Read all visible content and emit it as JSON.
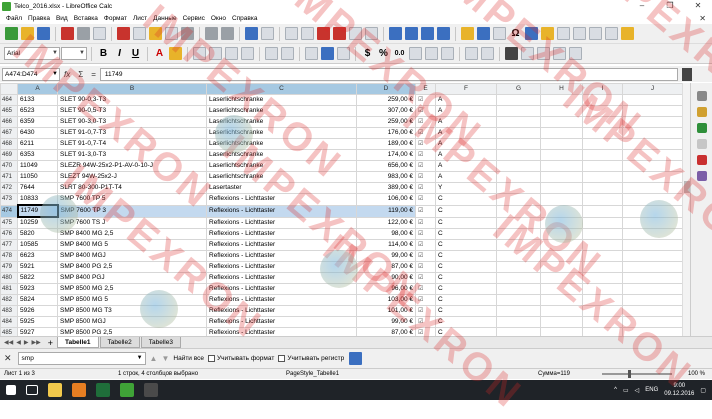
{
  "window": {
    "title": "Telco_2016.xlsx - LibreOffice Calc"
  },
  "menu": [
    "Файл",
    "Правка",
    "Вид",
    "Вставка",
    "Формат",
    "Лист",
    "Данные",
    "Сервис",
    "Окно",
    "Справка"
  ],
  "toolbar": {
    "font_name": "Arial",
    "currency_symbol": "$",
    "percent_symbol": "%",
    "number_format": "0.0",
    "omega_symbol": "Ω"
  },
  "formula_bar": {
    "name_box": "A474:D474",
    "fx_symbol": "fx",
    "sum_symbol": "Σ",
    "equals_symbol": "=",
    "content": "11749"
  },
  "columns": [
    "A",
    "B",
    "C",
    "D",
    "E",
    "F",
    "G",
    "H",
    "I",
    "J"
  ],
  "rows": [
    {
      "n": "464",
      "a": "6133",
      "b": "SLET 90-0,3-T3",
      "c": "Laserlichtschranke",
      "d": "259,00 €",
      "e": "☑",
      "f": "A"
    },
    {
      "n": "465",
      "a": "6523",
      "b": "SLET 90-0,5-T3",
      "c": "Laserlichtschranke",
      "d": "307,00 €",
      "e": "☑",
      "f": "A"
    },
    {
      "n": "466",
      "a": "6359",
      "b": "SLET 90-3,0-T3",
      "c": "Laserlichtschranke",
      "d": "259,00 €",
      "e": "☑",
      "f": "A"
    },
    {
      "n": "467",
      "a": "6430",
      "b": "SLET 91-0,7-T3",
      "c": "Laserlichtschranke",
      "d": "176,00 €",
      "e": "☑",
      "f": "A"
    },
    {
      "n": "468",
      "a": "6211",
      "b": "SLET 91-0,7-T4",
      "c": "Laserlichtschranke",
      "d": "189,00 €",
      "e": "☑",
      "f": "A"
    },
    {
      "n": "469",
      "a": "6353",
      "b": "SLET 91-3,0-T3",
      "c": "Laserlichtschranke",
      "d": "174,00 €",
      "e": "☑",
      "f": "A"
    },
    {
      "n": "470",
      "a": "11049",
      "b": "SLEZR 94W-25x2-P1-AV-0-10-J",
      "c": "Laserlichtschranke",
      "d": "656,00 €",
      "e": "☑",
      "f": "A"
    },
    {
      "n": "471",
      "a": "11050",
      "b": "SLEZT 94W-25x2-J",
      "c": "Laserlichtschranke",
      "d": "983,00 €",
      "e": "☑",
      "f": "A"
    },
    {
      "n": "472",
      "a": "7644",
      "b": "SLRT 80-300-P1T-T4",
      "c": "Lasertaster",
      "d": "389,00 €",
      "e": "☑",
      "f": "Y"
    },
    {
      "n": "473",
      "a": "10833",
      "b": "SMP 7600 TP 5",
      "c": "Reflexions - Lichttaster",
      "d": "106,00 €",
      "e": "☑",
      "f": "C"
    },
    {
      "n": "474",
      "a": "11749",
      "b": "SMP 7600 TP 3",
      "c": "Reflexions - Lichttaster",
      "d": "119,00 €",
      "e": "☑",
      "f": "C"
    },
    {
      "n": "475",
      "a": "10259",
      "b": "SMP 7600 TS J",
      "c": "Reflexions - Lichttaster",
      "d": "122,00 €",
      "e": "☑",
      "f": "C"
    },
    {
      "n": "476",
      "a": "5820",
      "b": "SMP 8400 MG 2,5",
      "c": "Reflexions - Lichttaster",
      "d": "98,00 €",
      "e": "☑",
      "f": "C"
    },
    {
      "n": "477",
      "a": "10585",
      "b": "SMP 8400 MG 5",
      "c": "Reflexions - Lichttaster",
      "d": "114,00 €",
      "e": "☑",
      "f": "C"
    },
    {
      "n": "478",
      "a": "6623",
      "b": "SMP 8400 MGJ",
      "c": "Reflexions - Lichttaster",
      "d": "99,00 €",
      "e": "☑",
      "f": "C"
    },
    {
      "n": "479",
      "a": "5921",
      "b": "SMP 8400 PG 2,5",
      "c": "Reflexions - Lichttaster",
      "d": "87,00 €",
      "e": "☑",
      "f": "C"
    },
    {
      "n": "480",
      "a": "5822",
      "b": "SMP 8400 PGJ",
      "c": "Reflexions - Lichttaster",
      "d": "90,00 €",
      "e": "☑",
      "f": "C"
    },
    {
      "n": "481",
      "a": "5923",
      "b": "SMP 8500 MG 2,5",
      "c": "Reflexions - Lichttaster",
      "d": "96,00 €",
      "e": "☑",
      "f": "C"
    },
    {
      "n": "482",
      "a": "5824",
      "b": "SMP 8500 MG 5",
      "c": "Reflexions - Lichttaster",
      "d": "103,00 €",
      "e": "☑",
      "f": "C"
    },
    {
      "n": "483",
      "a": "5926",
      "b": "SMP 8500 MG T3",
      "c": "Reflexions - Lichttaster",
      "d": "101,00 €",
      "e": "☑",
      "f": "C"
    },
    {
      "n": "484",
      "a": "5925",
      "b": "SMP 8500 MGJ",
      "c": "Reflexions - Lichttaster",
      "d": "99,00 €",
      "e": "☑",
      "f": "C"
    },
    {
      "n": "485",
      "a": "5927",
      "b": "SMP 8500 PG 2,5",
      "c": "Reflexions - Lichttaster",
      "d": "87,00 €",
      "e": "☑",
      "f": "C"
    }
  ],
  "sheets": [
    "Tabelle1",
    "Tabelle2",
    "Tabelle3"
  ],
  "find": {
    "value": "smp",
    "find_all": "Найти все",
    "match_format": "Учитывать формат",
    "match_case": "Учитывать регистр"
  },
  "status": {
    "sheet": "Лист 1 из 3",
    "selection": "1 строк, 4 столбцов выбрано",
    "page_style": "PageStyle_Tabelle1",
    "sum": "Сумма=119",
    "zoom": "100 %"
  },
  "taskbar": {
    "lang": "ENG",
    "time": "9:00",
    "date": "09.12.2016"
  },
  "watermark": "IMPEXRON",
  "colors": {
    "selection": "#c3d9ef",
    "header": "#eef0f2",
    "watermark": "#dc2828"
  }
}
